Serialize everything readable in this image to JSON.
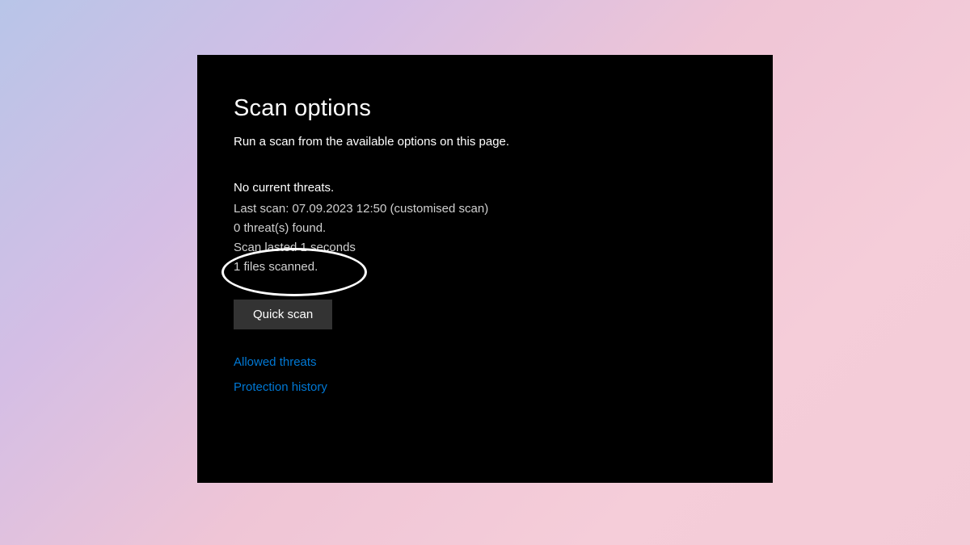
{
  "title": "Scan options",
  "subtitle": "Run a scan from the available options on this page.",
  "status": {
    "heading": "No current threats.",
    "last_scan": "Last scan: 07.09.2023 12:50 (customised scan)",
    "threats_found": "0 threat(s) found.",
    "scan_duration": "Scan lasted 1 seconds",
    "files_scanned": "1 files scanned."
  },
  "quick_scan_label": "Quick scan",
  "links": {
    "allowed_threats": "Allowed threats",
    "protection_history": "Protection history"
  }
}
